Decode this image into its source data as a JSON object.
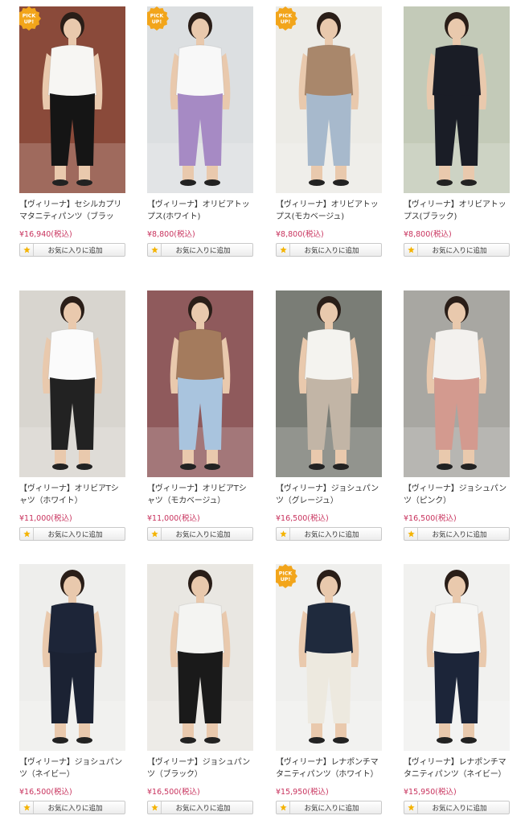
{
  "favorite_label": "お気に入りに追加",
  "pick_badge": [
    "PICK",
    "UP!"
  ],
  "colors": {
    "price": "#c8325d",
    "badge": "#f2a51b",
    "star": "#f4b300"
  },
  "products": [
    {
      "name": "【ヴィリーナ】セシルカプリマタニティパンツ（ブラック）",
      "price": "¥16,940(税込)",
      "pick": true,
      "top": "#f7f6f3",
      "bottom": "#151515",
      "bg": "#8a4a3a"
    },
    {
      "name": "【ヴィリーナ】オリビアトップス(ホワイト)",
      "price": "¥8,800(税込)",
      "pick": true,
      "top": "#f8f8f8",
      "bottom": "#a68ac4",
      "bg": "#dcdfe1"
    },
    {
      "name": "【ヴィリーナ】オリビアトップス(モカベージュ)",
      "price": "¥8,800(税込)",
      "pick": true,
      "top": "#a9876b",
      "bottom": "#a7b9cc",
      "bg": "#ecebe6"
    },
    {
      "name": "【ヴィリーナ】オリビアトップス(ブラック)",
      "price": "¥8,800(税込)",
      "pick": false,
      "top": "#1a1d26",
      "bottom": "#1a1d26",
      "bg": "#c3cab8"
    },
    {
      "name": "【ヴィリーナ】オリビアTシャツ（ホワイト）",
      "price": "¥11,000(税込)",
      "pick": false,
      "top": "#fbfbfb",
      "bottom": "#222222",
      "bg": "#d8d5cf"
    },
    {
      "name": "【ヴィリーナ】オリビアTシャツ（モカベージュ）",
      "price": "¥11,000(税込)",
      "pick": false,
      "top": "#a47b5d",
      "bottom": "#a9c4de",
      "bg": "#8f5a5c"
    },
    {
      "name": "【ヴィリーナ】ジョシュパンツ（グレージュ）",
      "price": "¥16,500(税込)",
      "pick": false,
      "top": "#f4f3ef",
      "bottom": "#c2b5a6",
      "bg": "#7a7d76"
    },
    {
      "name": "【ヴィリーナ】ジョシュパンツ（ピンク）",
      "price": "¥16,500(税込)",
      "pick": false,
      "top": "#f3f1ee",
      "bottom": "#d39a8f",
      "bg": "#a8a7a2"
    },
    {
      "name": "【ヴィリーナ】ジョシュパンツ（ネイビー）",
      "price": "¥16,500(税込)",
      "pick": false,
      "top": "#1d2538",
      "bottom": "#1b2233",
      "bg": "#eeeeec"
    },
    {
      "name": "【ヴィリーナ】ジョシュパンツ（ブラック）",
      "price": "¥16,500(税込)",
      "pick": false,
      "top": "#f4f4f2",
      "bottom": "#1a1a1a",
      "bg": "#e9e7e2"
    },
    {
      "name": "【ヴィリーナ】レナポンチマタニティパンツ（ホワイト）",
      "price": "¥15,950(税込)",
      "pick": true,
      "top": "#1f2a3d",
      "bottom": "#ede9df",
      "bg": "#efefed"
    },
    {
      "name": "【ヴィリーナ】レナポンチマタニティパンツ（ネイビー）",
      "price": "¥15,950(税込)",
      "pick": false,
      "top": "#f6f6f4",
      "bottom": "#1c2539",
      "bg": "#f1f1ef"
    }
  ]
}
